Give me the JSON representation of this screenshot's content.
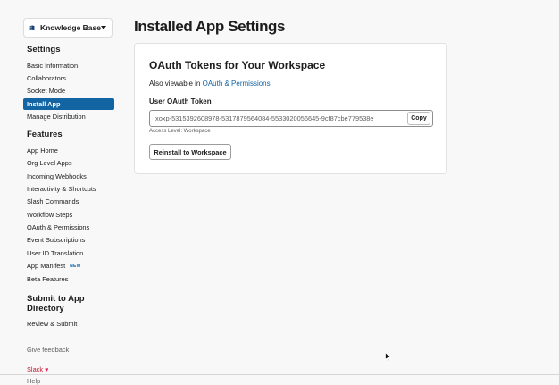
{
  "app_selector": {
    "name": "Knowledge Base",
    "icon": "book-icon"
  },
  "sidebar": {
    "settings_heading": "Settings",
    "settings_items": [
      {
        "label": "Basic Information"
      },
      {
        "label": "Collaborators"
      },
      {
        "label": "Socket Mode"
      },
      {
        "label": "Install App",
        "active": true
      },
      {
        "label": "Manage Distribution"
      }
    ],
    "features_heading": "Features",
    "features_items": [
      {
        "label": "App Home"
      },
      {
        "label": "Org Level Apps"
      },
      {
        "label": "Incoming Webhooks"
      },
      {
        "label": "Interactivity & Shortcuts"
      },
      {
        "label": "Slash Commands"
      },
      {
        "label": "Workflow Steps"
      },
      {
        "label": "OAuth & Permissions"
      },
      {
        "label": "Event Subscriptions"
      },
      {
        "label": "User ID Translation"
      },
      {
        "label": "App Manifest",
        "badge": "NEW"
      },
      {
        "label": "Beta Features"
      }
    ],
    "submit_heading_line1": "Submit to App",
    "submit_heading_line2": "Directory",
    "submit_items": [
      {
        "label": "Review & Submit"
      }
    ],
    "feedback": "Give feedback",
    "slack_link": "Slack",
    "help_link": "Help"
  },
  "main": {
    "title": "Installed App Settings",
    "card": {
      "title": "OAuth Tokens for Your Workspace",
      "also_prefix": "Also viewable in ",
      "also_link": "OAuth & Permissions",
      "token_label": "User OAuth Token",
      "token_value": "xoxp-5315392608978-5317879564084-5533020056645-9cf87cbe779538e",
      "copy_label": "Copy",
      "access_level": "Access Level: Workspace",
      "reinstall_label": "Reinstall to Workspace"
    }
  },
  "colors": {
    "accent": "#1264a3",
    "text": "#1d1c1d",
    "muted": "#616061",
    "slack_red": "#e01e5a"
  }
}
